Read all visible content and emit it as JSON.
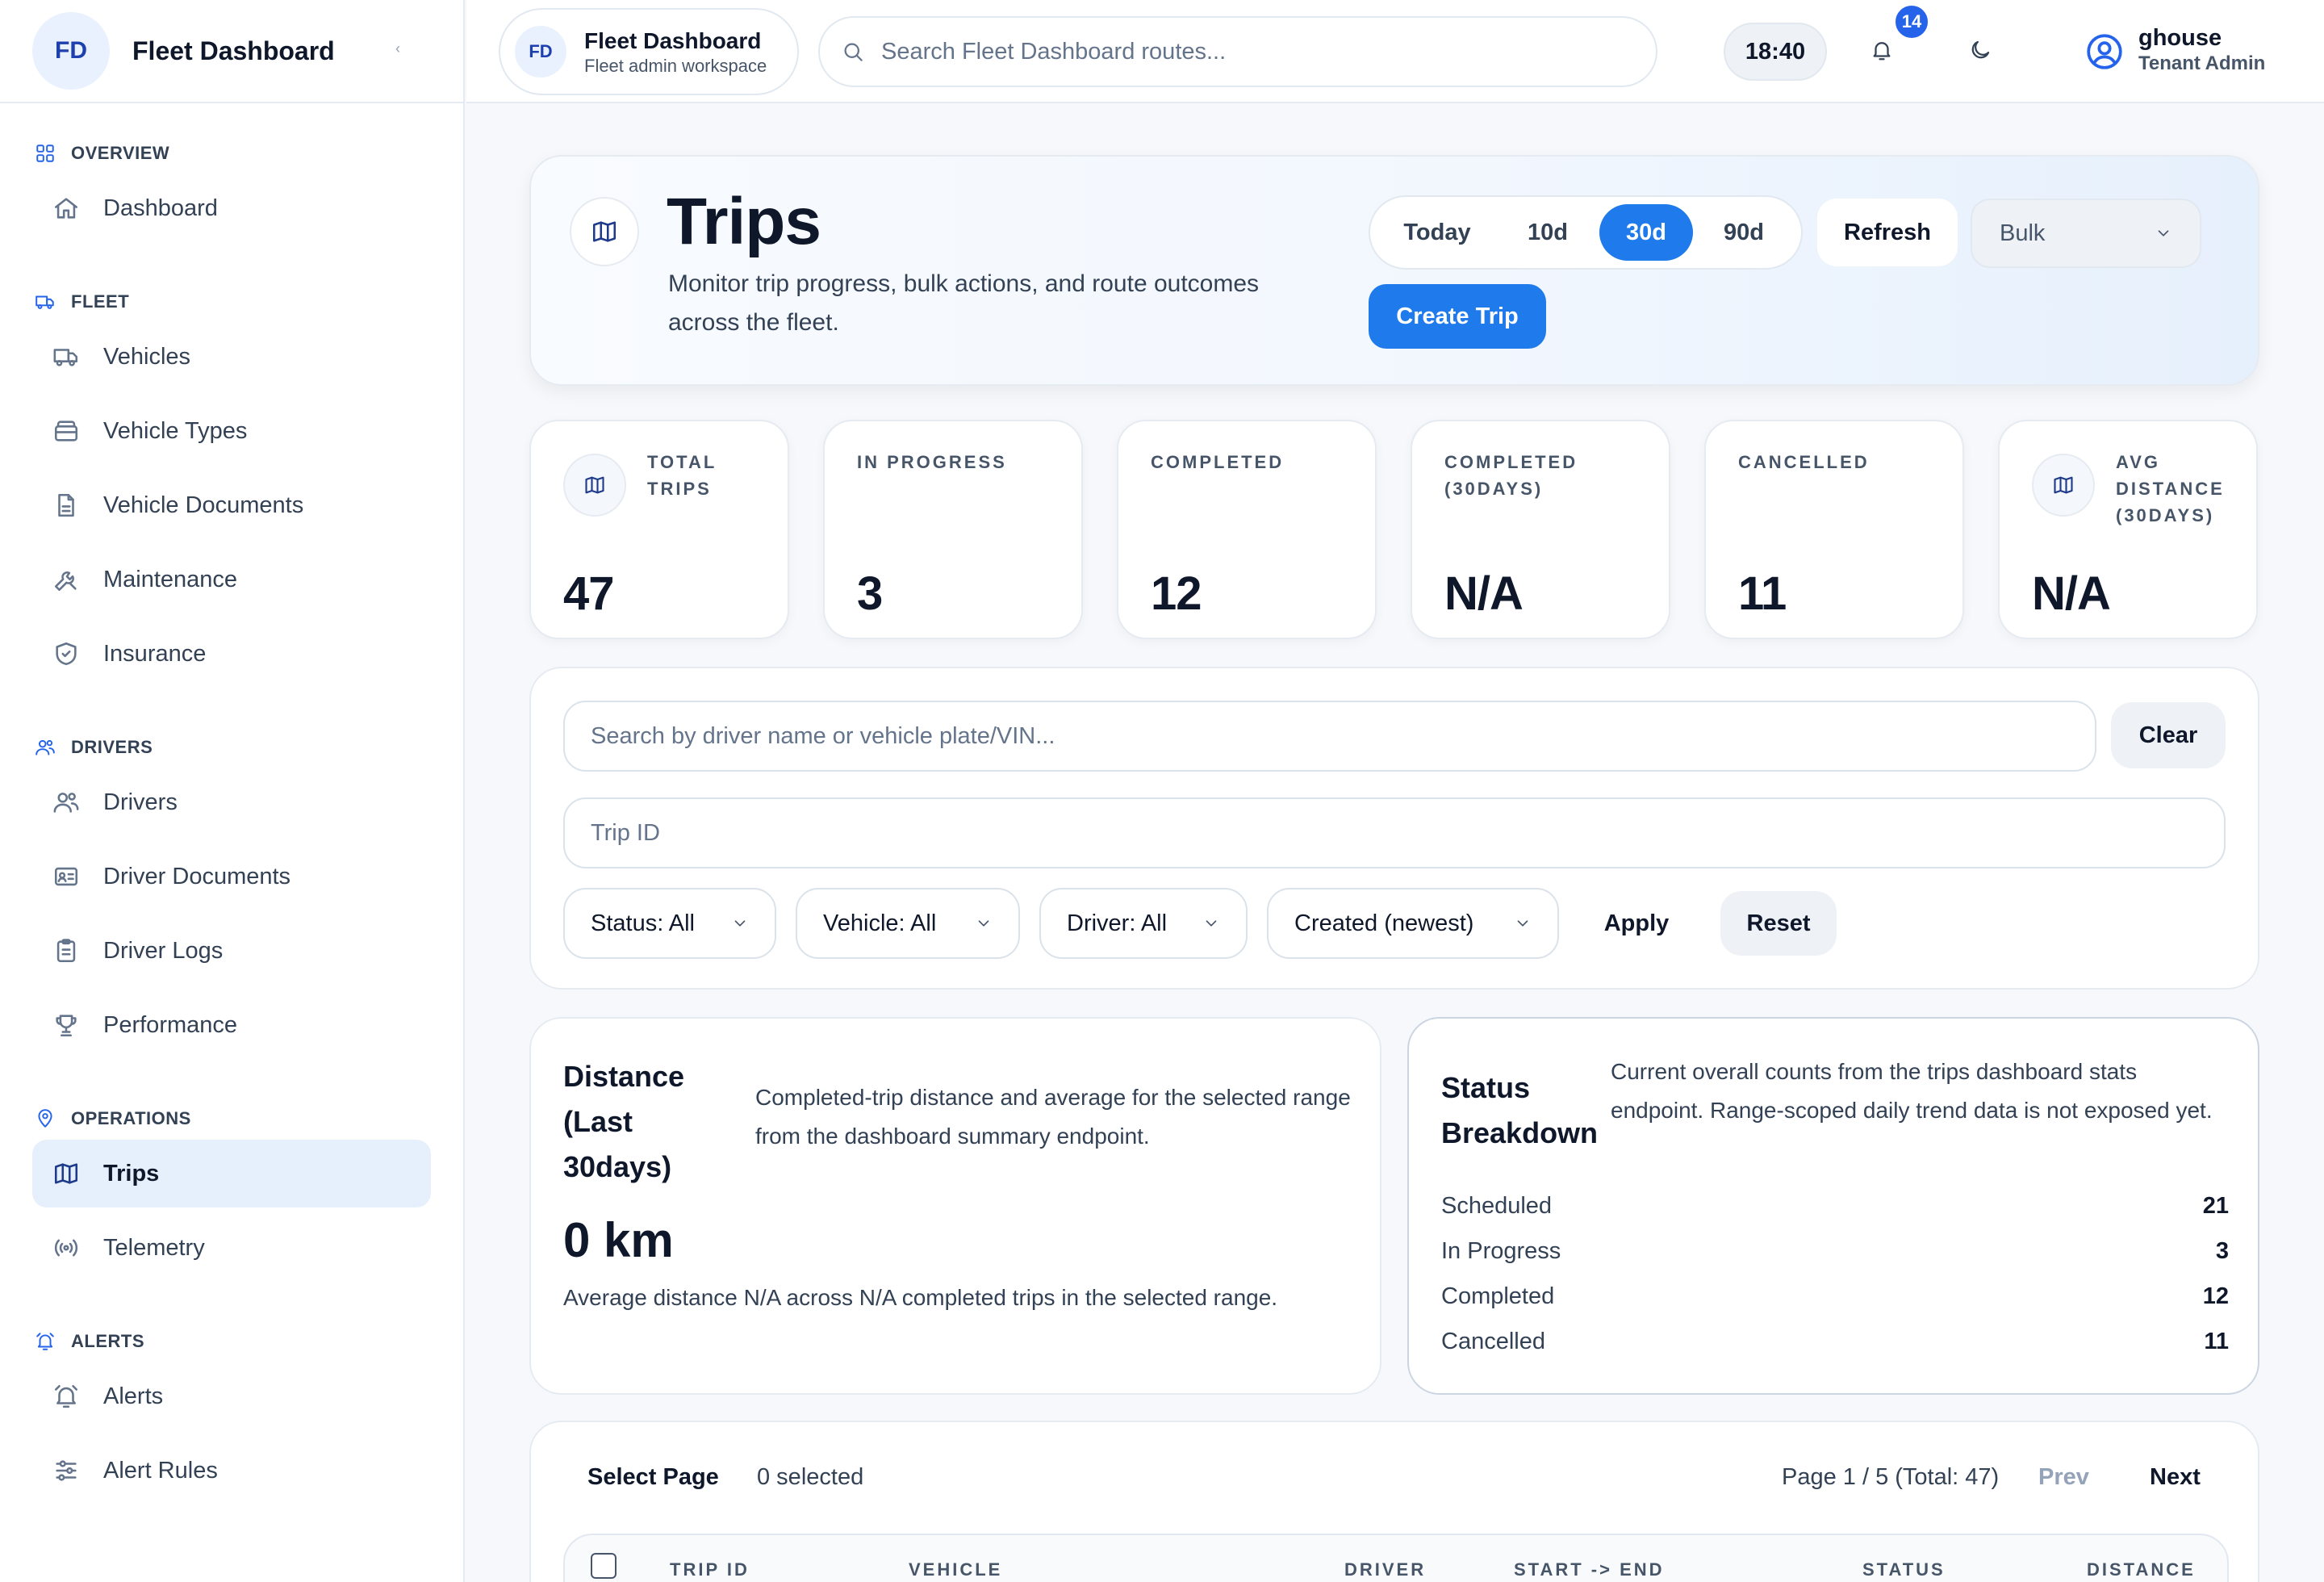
{
  "brand": {
    "logo": "FD",
    "name": "Fleet Dashboard",
    "collapse": "‹"
  },
  "nav": {
    "overview": {
      "label": "OVERVIEW",
      "icon": "grid-icon"
    },
    "dashboard": "Dashboard",
    "fleet": {
      "label": "FLEET",
      "icon": "truck-icon"
    },
    "vehicles": "Vehicles",
    "vehicle_types": "Vehicle Types",
    "vehicle_documents": "Vehicle Documents",
    "maintenance": "Maintenance",
    "insurance": "Insurance",
    "drivers_section": {
      "label": "DRIVERS",
      "icon": "users-icon"
    },
    "drivers": "Drivers",
    "driver_documents": "Driver Documents",
    "driver_logs": "Driver Logs",
    "performance": "Performance",
    "operations": {
      "label": "OPERATIONS",
      "icon": "map-pin-icon"
    },
    "trips": "Trips",
    "telemetry": "Telemetry",
    "alerts_section": {
      "label": "ALERTS",
      "icon": "bell-icon"
    },
    "alerts": "Alerts",
    "alert_rules": "Alert Rules"
  },
  "topbar": {
    "workspace": {
      "logo": "FD",
      "title": "Fleet Dashboard",
      "subtitle": "Fleet admin workspace"
    },
    "search_placeholder": "Search Fleet Dashboard routes...",
    "clock": "18:40",
    "notifications": "14",
    "user": {
      "name": "ghouse",
      "role": "Tenant Admin"
    }
  },
  "hero": {
    "title": "Trips",
    "subtitle": "Monitor trip progress, bulk actions, and route outcomes across the fleet.",
    "ranges": [
      "Today",
      "10d",
      "30d",
      "90d"
    ],
    "active_range": "30d",
    "refresh": "Refresh",
    "bulk": "Bulk",
    "create": "Create Trip"
  },
  "stats": [
    {
      "label": "TOTAL TRIPS",
      "value": "47"
    },
    {
      "label": "IN PROGRESS",
      "value": "3"
    },
    {
      "label": "COMPLETED",
      "value": "12"
    },
    {
      "label": "COMPLETED (30DAYS)",
      "value": "N/A"
    },
    {
      "label": "CANCELLED",
      "value": "11"
    },
    {
      "label": "AVG DISTANCE (30DAYS)",
      "value": "N/A"
    }
  ],
  "filters": {
    "search_placeholder": "Search by driver name or vehicle plate/VIN...",
    "clear": "Clear",
    "trip_id_placeholder": "Trip ID",
    "status": "Status: All",
    "vehicle": "Vehicle: All",
    "driver": "Driver: All",
    "sort": "Created (newest)",
    "apply": "Apply",
    "reset": "Reset"
  },
  "distance": {
    "title": "Distance (Last 30days)",
    "description": "Completed-trip distance and average for the selected range from the dashboard summary endpoint.",
    "value": "0 km",
    "note": "Average distance N/A across N/A completed trips in the selected range."
  },
  "status_breakdown": {
    "title": "Status Breakdown",
    "description": "Current overall counts from the trips dashboard stats endpoint. Range-scoped daily trend data is not exposed yet.",
    "rows": [
      {
        "label": "Scheduled",
        "value": "21"
      },
      {
        "label": "In Progress",
        "value": "3"
      },
      {
        "label": "Completed",
        "value": "12"
      },
      {
        "label": "Cancelled",
        "value": "11"
      }
    ]
  },
  "table": {
    "select_page": "Select Page",
    "selected": "0 selected",
    "page_info": "Page 1 / 5 (Total: 47)",
    "prev": "Prev",
    "next": "Next",
    "columns": [
      "TRIP ID",
      "VEHICLE",
      "DRIVER",
      "START -> END",
      "STATUS",
      "DISTANCE"
    ]
  },
  "colors": {
    "accent": "#1f7aec",
    "active_nav_bg": "#e6f0fc",
    "text": "#0f172a"
  }
}
